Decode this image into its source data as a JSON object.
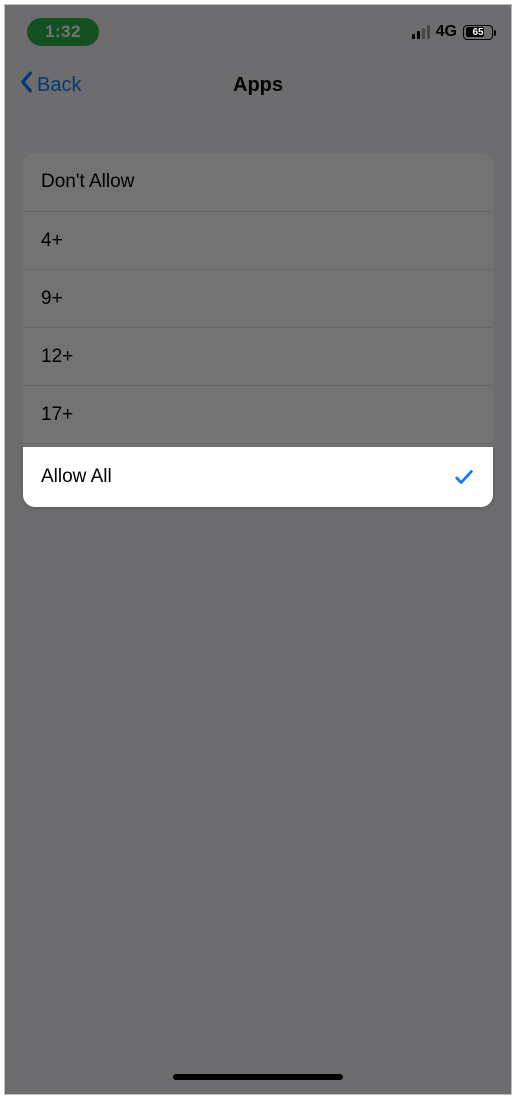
{
  "status": {
    "time": "1:32",
    "network": "4G",
    "battery_level": "65"
  },
  "nav": {
    "back_label": "Back",
    "title": "Apps"
  },
  "options": {
    "dont_allow": "Don't Allow",
    "four_plus": "4+",
    "nine_plus": "9+",
    "twelve_plus": "12+",
    "seventeen_plus": "17+",
    "allow_all": "Allow All"
  },
  "selected_option": "allow_all",
  "colors": {
    "accent": "#0a7aff",
    "time_pill": "#30b14e"
  }
}
